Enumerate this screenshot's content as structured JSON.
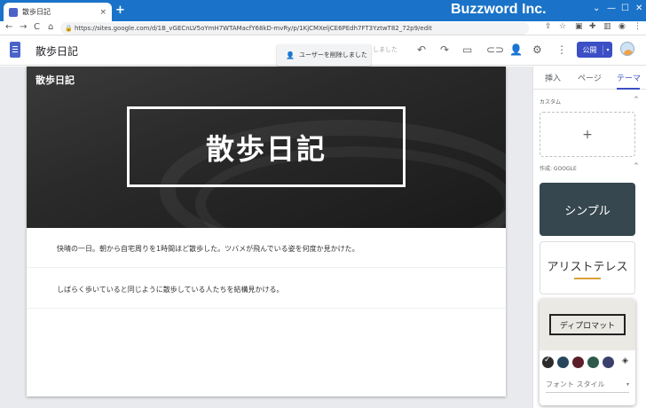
{
  "browser": {
    "tab_title": "散歩日記",
    "tab_close": "×",
    "new_tab": "+",
    "brand": "Buzzword Inc.",
    "url": "https://sites.google.com/d/1B_vGECnLV5oYmH7WTAMacfY68kD-mvRy/p/1KjCMXeljCE6PEdh7FT3YztwT82_72p9/edit",
    "nav_back": "←",
    "nav_forward": "→",
    "nav_reload": "C",
    "nav_home": "⌂",
    "lock": "🔒"
  },
  "editor": {
    "site_title": "散歩日記",
    "toast": "ユーザーを削除しました",
    "ghost_text": "しました",
    "publish_label": "公開",
    "publish_dropdown": "▾"
  },
  "page": {
    "header_small": "散歩日記",
    "hero_title": "散歩日記",
    "paragraph1": "快晴の一日。朝から自宅周りを1時間ほど散歩した。ツバメが飛んでいる姿を何度か見かけた。",
    "paragraph2": "しばらく歩いていると同じように散歩している人たちを結構見かける。"
  },
  "panel": {
    "tabs": [
      "挿入",
      "ページ",
      "テーマ"
    ],
    "active_tab": "テーマ",
    "section_custom": "カスタム",
    "add_label": "+",
    "section_google": "作成: GOOGLE",
    "collapse_icon": "^",
    "themes": {
      "simple": "シンプル",
      "aristotle": "アリストテレス",
      "diplomat": "ディプロマット"
    },
    "font_style_label": "フォント スタイル",
    "font_dropdown": "▾",
    "swatch_colors": [
      "#2b2b2b",
      "#27465c",
      "#5c1e2b",
      "#2d5a4a",
      "#3a3f6b"
    ],
    "fill_icon": "◈"
  },
  "colors": {
    "accent": "#3c4fc5",
    "chrome": "#1a73c8"
  }
}
